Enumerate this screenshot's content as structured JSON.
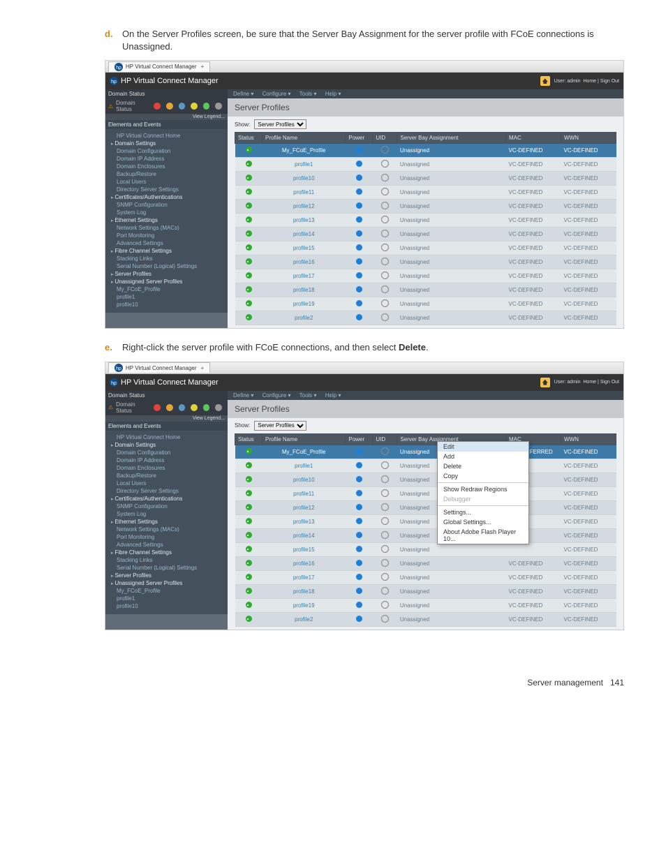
{
  "steps": {
    "d": {
      "letter": "d.",
      "text": "On the Server Profiles screen, be sure that the Server Bay Assignment for the server profile with FCoE connections is Unassigned."
    },
    "e": {
      "letter": "e.",
      "text_pre": "Right-click the server profile with FCoE connections, and then select ",
      "bold": "Delete",
      "text_post": "."
    }
  },
  "footer": {
    "label": "Server management",
    "page": "141"
  },
  "app": {
    "tab": "HP Virtual Connect Manager",
    "title": "HP Virtual Connect Manager",
    "user": "User: admin",
    "links": "Home | Sign Out",
    "menu": {
      "define": "Define ▾",
      "configure": "Configure ▾",
      "tools": "Tools ▾",
      "help": "Help ▾"
    },
    "sidebar": {
      "domain_status": "Domain Status",
      "legend": "View Legend...",
      "elements": "Elements and Events",
      "items": [
        {
          "t": "HP Virtual Connect Home",
          "h": 0
        },
        {
          "t": "Domain Settings",
          "h": 1
        },
        {
          "t": "Domain Configuration",
          "h": 0
        },
        {
          "t": "Domain IP Address",
          "h": 0
        },
        {
          "t": "Domain Enclosures",
          "h": 0
        },
        {
          "t": "Backup/Restore",
          "h": 0
        },
        {
          "t": "Local Users",
          "h": 0
        },
        {
          "t": "Directory Server Settings",
          "h": 0
        },
        {
          "t": "Certificates/Authentications",
          "h": 1
        },
        {
          "t": "SNMP Configuration",
          "h": 0
        },
        {
          "t": "System Log",
          "h": 0
        },
        {
          "t": "Ethernet Settings",
          "h": 1
        },
        {
          "t": "Network Settings (MACs)",
          "h": 0
        },
        {
          "t": "Port Monitoring",
          "h": 0
        },
        {
          "t": "Advanced Settings",
          "h": 0
        },
        {
          "t": "Fibre Channel Settings",
          "h": 1
        },
        {
          "t": "Stacking Links",
          "h": 0
        },
        {
          "t": "Serial Number (Logical) Settings",
          "h": 0
        },
        {
          "t": "Server Profiles",
          "h": 1
        },
        {
          "t": "Unassigned Server Profiles",
          "h": 1
        },
        {
          "t": "My_FCoE_Profile",
          "h": 0
        },
        {
          "t": "profile1",
          "h": 0
        },
        {
          "t": "profile10",
          "h": 0
        }
      ]
    },
    "main": {
      "heading": "Server Profiles",
      "show_label": "Show:",
      "show_value": "Server Profiles",
      "cols": {
        "status": "Status",
        "name": "Profile Name",
        "power": "Power",
        "uid": "UID",
        "bay": "Server Bay Assignment",
        "mac": "MAC",
        "wwn": "WWN"
      }
    },
    "rows": [
      {
        "name": "My_FCoE_Profile",
        "bay": "Unassigned",
        "mac": "VC-DEFINED",
        "wwn": "VC-DEFINED",
        "hl": 1
      },
      {
        "name": "profile1",
        "bay": "Unassigned",
        "mac": "VC-DEFINED",
        "wwn": "VC-DEFINED"
      },
      {
        "name": "profile10",
        "bay": "Unassigned",
        "mac": "VC-DEFINED",
        "wwn": "VC-DEFINED"
      },
      {
        "name": "profile11",
        "bay": "Unassigned",
        "mac": "VC-DEFINED",
        "wwn": "VC-DEFINED"
      },
      {
        "name": "profile12",
        "bay": "Unassigned",
        "mac": "VC-DEFINED",
        "wwn": "VC-DEFINED"
      },
      {
        "name": "profile13",
        "bay": "Unassigned",
        "mac": "VC-DEFINED",
        "wwn": "VC-DEFINED"
      },
      {
        "name": "profile14",
        "bay": "Unassigned",
        "mac": "VC-DEFINED",
        "wwn": "VC-DEFINED"
      },
      {
        "name": "profile15",
        "bay": "Unassigned",
        "mac": "VC-DEFINED",
        "wwn": "VC-DEFINED"
      },
      {
        "name": "profile16",
        "bay": "Unassigned",
        "mac": "VC-DEFINED",
        "wwn": "VC-DEFINED"
      },
      {
        "name": "profile17",
        "bay": "Unassigned",
        "mac": "VC-DEFINED",
        "wwn": "VC-DEFINED"
      },
      {
        "name": "profile18",
        "bay": "Unassigned",
        "mac": "VC-DEFINED",
        "wwn": "VC-DEFINED"
      },
      {
        "name": "profile19",
        "bay": "Unassigned",
        "mac": "VC-DEFINED",
        "wwn": "VC-DEFINED"
      },
      {
        "name": "profile2",
        "bay": "Unassigned",
        "mac": "VC-DEFINED",
        "wwn": "VC-DEFINED"
      }
    ],
    "rows2": [
      {
        "name": "My_FCoE_Profile",
        "bay": "Unassigned",
        "mac": "UP-PREFERRED",
        "wwn": "VC-DEFINED",
        "hl": 1
      },
      {
        "name": "profile1",
        "bay": "Unassigned",
        "mac": "",
        "wwn": "VC-DEFINED"
      },
      {
        "name": "profile10",
        "bay": "Unassigned",
        "mac": "",
        "wwn": "VC-DEFINED"
      },
      {
        "name": "profile11",
        "bay": "Unassigned",
        "mac": "",
        "wwn": "VC-DEFINED"
      },
      {
        "name": "profile12",
        "bay": "Unassigned",
        "mac": "",
        "wwn": "VC-DEFINED"
      },
      {
        "name": "profile13",
        "bay": "Unassigned",
        "mac": "",
        "wwn": "VC-DEFINED"
      },
      {
        "name": "profile14",
        "bay": "Unassigned",
        "mac": "",
        "wwn": "VC-DEFINED"
      },
      {
        "name": "profile15",
        "bay": "Unassigned",
        "mac": "",
        "wwn": "VC-DEFINED"
      },
      {
        "name": "profile16",
        "bay": "Unassigned",
        "mac": "VC-DEFINED",
        "wwn": "VC-DEFINED"
      },
      {
        "name": "profile17",
        "bay": "Unassigned",
        "mac": "VC-DEFINED",
        "wwn": "VC-DEFINED"
      },
      {
        "name": "profile18",
        "bay": "Unassigned",
        "mac": "VC-DEFINED",
        "wwn": "VC-DEFINED"
      },
      {
        "name": "profile19",
        "bay": "Unassigned",
        "mac": "VC-DEFINED",
        "wwn": "VC-DEFINED"
      },
      {
        "name": "profile2",
        "bay": "Unassigned",
        "mac": "VC-DEFINED",
        "wwn": "VC-DEFINED"
      }
    ],
    "ctx": {
      "edit": "Edit",
      "add": "Add",
      "del": "Delete",
      "copy": "Copy",
      "redraw": "Show Redraw Regions",
      "debug": "Debugger",
      "settings": "Settings...",
      "global": "Global Settings...",
      "flash": "About Adobe Flash Player 10..."
    }
  }
}
